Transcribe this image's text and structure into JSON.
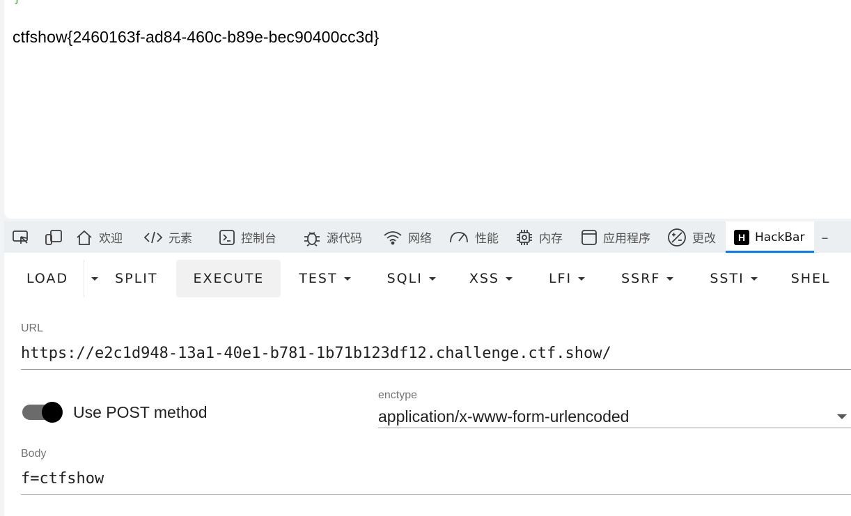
{
  "page": {
    "brace": "}",
    "flag_text": "ctfshow{2460163f-ad84-460c-b89e-bec90400cc3d}"
  },
  "devtools": {
    "tabs": [
      {
        "icon": "house-icon",
        "label": "欢迎"
      },
      {
        "icon": "code-icon",
        "label": "元素"
      },
      {
        "icon": "terminal-icon",
        "label": "控制台"
      },
      {
        "icon": "bug-icon",
        "label": "源代码"
      },
      {
        "icon": "wifi-icon",
        "label": "网络"
      },
      {
        "icon": "gauge-icon",
        "label": "性能"
      },
      {
        "icon": "chip-icon",
        "label": "内存"
      },
      {
        "icon": "window-icon",
        "label": "应用程序"
      },
      {
        "icon": "changes-icon",
        "label": "更改"
      },
      {
        "icon": "hackbar-icon",
        "label": "HackBar"
      }
    ],
    "active_tab": "HackBar",
    "hackbar_badge": "H",
    "more_icon": "plus-icon",
    "accent_color": "#1a73e8"
  },
  "hackbar": {
    "toolbar": {
      "load": "LOAD",
      "split": "SPLIT",
      "execute": "EXECUTE",
      "test": "TEST",
      "sqli": "SQLI",
      "xss": "XSS",
      "lfi": "LFI",
      "ssrf": "SSRF",
      "ssti": "SSTI",
      "shell": "SHEL"
    },
    "url_label": "URL",
    "url_value": "https://e2c1d948-13a1-40e1-b781-1b71b123df12.challenge.ctf.show/",
    "post_toggle_label": "Use POST method",
    "post_enabled": true,
    "enctype_label": "enctype",
    "enctype_value": "application/x-www-form-urlencoded",
    "body_label": "Body",
    "body_value": "f=ctfshow"
  }
}
